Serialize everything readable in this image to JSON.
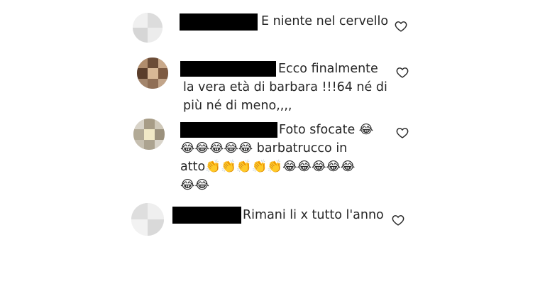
{
  "comments": [
    {
      "text_lines": [
        "E niente nel cervello"
      ],
      "avatar_color": "#e2e2e2",
      "liked": false
    },
    {
      "text_lines": [
        "Ecco finalmente",
        "la vera età di barbara !!!64 né di",
        "più né di meno,,,,"
      ],
      "avatar_color": "#8a6d55",
      "liked": false
    },
    {
      "text_lines": [
        "Foto sfocate 😂",
        "😂😂😂😂😂 barbatrucco in",
        "atto👏👏👏👏👏😂😂😂😂😂",
        "😂😂"
      ],
      "avatar_color": "#bfb7a6",
      "liked": false
    },
    {
      "text_lines": [
        "Rimani li x tutto l'anno"
      ],
      "avatar_color": "#e4e4e4",
      "liked": false
    }
  ],
  "icons": {
    "like": "heart-outline-icon"
  },
  "colors": {
    "text": "#262626",
    "redaction": "#000000",
    "heart_stroke": "#262626"
  }
}
